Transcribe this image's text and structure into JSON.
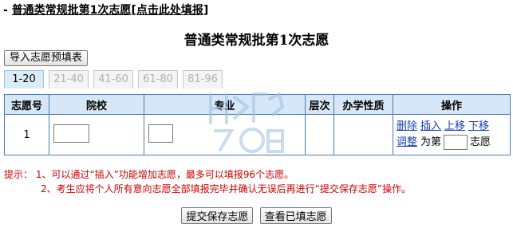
{
  "header": {
    "prefix": "- ",
    "section": "普通类常规批第1次志愿",
    "link": "[点击此处填报]"
  },
  "page_title": "普通类常规批第1次志愿",
  "import_button": "导入志愿预填表",
  "tabs": [
    "1-20",
    "21-40",
    "41-60",
    "61-80",
    "81-96"
  ],
  "table": {
    "headers": [
      "志愿号",
      "院校",
      "专业",
      "层次",
      "办学性质",
      "操作"
    ],
    "row": {
      "number": "1",
      "ops": {
        "delete": "删除",
        "insert": "插入",
        "up": "上移",
        "down": "下移",
        "adjust": "调整",
        "position_prefix": "为第",
        "position_suffix": "志愿"
      }
    }
  },
  "notes": {
    "line1": "提示：  1、可以通过“插入”功能增加志愿，最多可以填报96个志愿。",
    "line2": "2、考生应将个人所有意向志愿全部填报完毕并确认无误后再进行“提交保存志愿”操作。"
  },
  "buttons": {
    "submit": "提交保存志愿",
    "view": "查看已填志愿"
  },
  "watermark_icon": "watermark-logo-icon",
  "colors": {
    "header_bg": "#d7e7f7",
    "border": "#4a7bb0",
    "note_red": "#cc0000",
    "link_blue": "#1a3fb4"
  }
}
